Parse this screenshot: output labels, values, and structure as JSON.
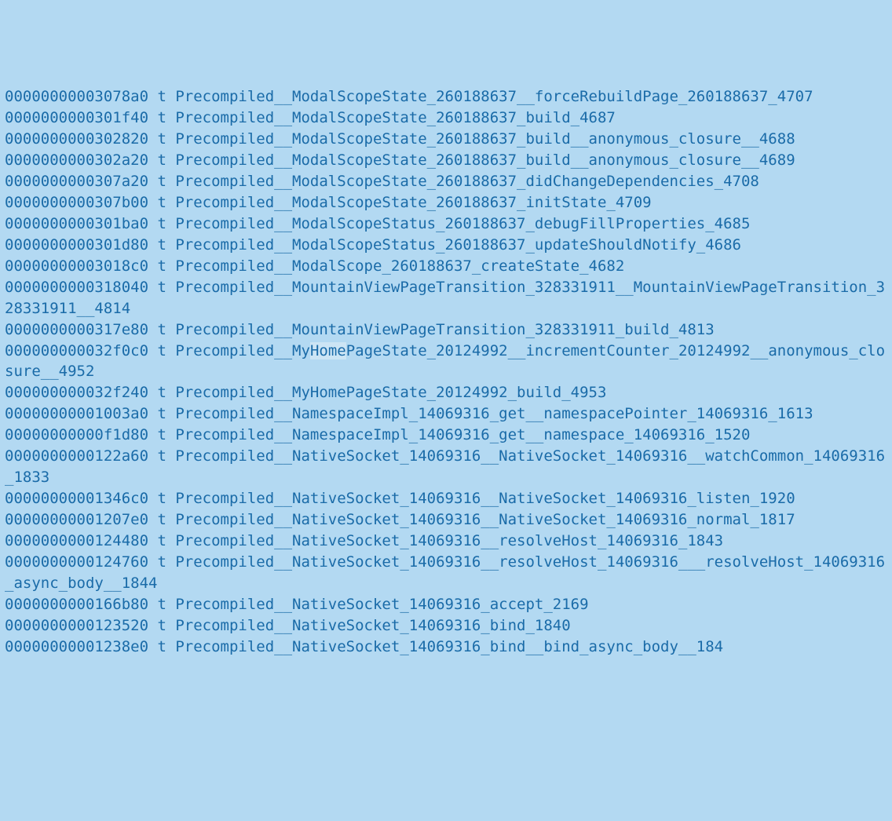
{
  "lines": [
    {
      "addr": "00000000003078a0",
      "type": "t",
      "symbol": "Precompiled__ModalScopeState_260188637__forceRebuildPage_260188637_4707"
    },
    {
      "addr": "0000000000301f40",
      "type": "t",
      "symbol": "Precompiled__ModalScopeState_260188637_build_4687"
    },
    {
      "addr": "0000000000302820",
      "type": "t",
      "symbol": "Precompiled__ModalScopeState_260188637_build__anonymous_closure__4688"
    },
    {
      "addr": "0000000000302a20",
      "type": "t",
      "symbol": "Precompiled__ModalScopeState_260188637_build__anonymous_closure__4689"
    },
    {
      "addr": "0000000000307a20",
      "type": "t",
      "symbol": "Precompiled__ModalScopeState_260188637_didChangeDependencies_4708"
    },
    {
      "addr": "0000000000307b00",
      "type": "t",
      "symbol": "Precompiled__ModalScopeState_260188637_initState_4709"
    },
    {
      "addr": "0000000000301ba0",
      "type": "t",
      "symbol": "Precompiled__ModalScopeStatus_260188637_debugFillProperties_4685"
    },
    {
      "addr": "0000000000301d80",
      "type": "t",
      "symbol": "Precompiled__ModalScopeStatus_260188637_updateShouldNotify_4686"
    },
    {
      "addr": "00000000003018c0",
      "type": "t",
      "symbol": "Precompiled__ModalScope_260188637_createState_4682"
    },
    {
      "addr": "0000000000318040",
      "type": "t",
      "symbol": "Precompiled__MountainViewPageTransition_328331911__MountainViewPageTransition_328331911__4814"
    },
    {
      "addr": "0000000000317e80",
      "type": "t",
      "symbol": "Precompiled__MountainViewPageTransition_328331911_build_4813"
    },
    {
      "addr": "000000000032f0c0",
      "type": "t",
      "symbol_pre": "Precompiled__My",
      "symbol_hl": "Home",
      "symbol_post": "PageState_20124992__incrementCounter_20124992__anonymous_closure__4952",
      "has_highlight": true
    },
    {
      "addr": "000000000032f240",
      "type": "t",
      "symbol": "Precompiled__MyHomePageState_20124992_build_4953"
    },
    {
      "addr": "00000000001003a0",
      "type": "t",
      "symbol": "Precompiled__NamespaceImpl_14069316_get__namespacePointer_14069316_1613"
    },
    {
      "addr": "00000000000f1d80",
      "type": "t",
      "symbol": "Precompiled__NamespaceImpl_14069316_get__namespace_14069316_1520"
    },
    {
      "addr": "0000000000122a60",
      "type": "t",
      "symbol": "Precompiled__NativeSocket_14069316__NativeSocket_14069316__watchCommon_14069316_1833"
    },
    {
      "addr": "00000000001346c0",
      "type": "t",
      "symbol": "Precompiled__NativeSocket_14069316__NativeSocket_14069316_listen_1920"
    },
    {
      "addr": "00000000001207e0",
      "type": "t",
      "symbol": "Precompiled__NativeSocket_14069316__NativeSocket_14069316_normal_1817"
    },
    {
      "addr": "0000000000124480",
      "type": "t",
      "symbol": "Precompiled__NativeSocket_14069316__resolveHost_14069316_1843"
    },
    {
      "addr": "0000000000124760",
      "type": "t",
      "symbol": "Precompiled__NativeSocket_14069316__resolveHost_14069316___resolveHost_14069316_async_body__1844"
    },
    {
      "addr": "0000000000166b80",
      "type": "t",
      "symbol": "Precompiled__NativeSocket_14069316_accept_2169"
    },
    {
      "addr": "0000000000123520",
      "type": "t",
      "symbol": "Precompiled__NativeSocket_14069316_bind_1840"
    },
    {
      "addr": "00000000001238e0",
      "type": "t",
      "symbol": "Precompiled__NativeSocket_14069316_bind__bind_async_body__184"
    }
  ]
}
